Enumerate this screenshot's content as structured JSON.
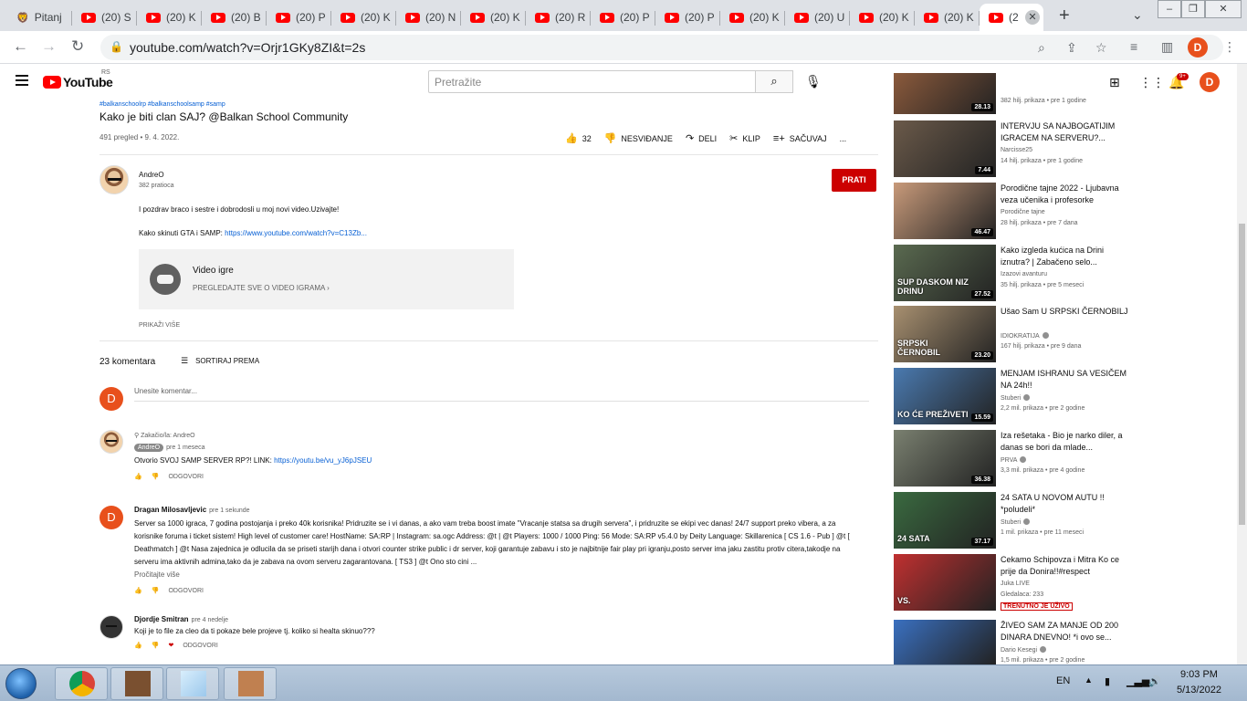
{
  "browser": {
    "tabs": [
      {
        "label": "Pitanj"
      },
      {
        "label": "(20) S"
      },
      {
        "label": "(20) K"
      },
      {
        "label": "(20) B"
      },
      {
        "label": "(20) P"
      },
      {
        "label": "(20) K"
      },
      {
        "label": "(20) N"
      },
      {
        "label": "(20) K"
      },
      {
        "label": "(20) R"
      },
      {
        "label": "(20) P"
      },
      {
        "label": "(20) P"
      },
      {
        "label": "(20) K"
      },
      {
        "label": "(20) U"
      },
      {
        "label": "(20) K"
      },
      {
        "label": "(20) K"
      },
      {
        "label": "(2"
      }
    ],
    "url": "youtube.com/watch?v=Orjr1GKy8ZI&t=2s",
    "profile_initial": "D"
  },
  "youtube": {
    "logo_text": "YouTube",
    "region": "RS",
    "search_placeholder": "Pretražite",
    "notif_count": "9+",
    "avatar_initial": "D"
  },
  "video": {
    "hashtags": "#balkanschoolrp #balkanschoolsamp #samp",
    "title": "Kako je biti clan SAJ? @Balkan School Community",
    "meta": "491 pregled • 9. 4. 2022.",
    "likes": "32",
    "dislike_label": "NESVIĐANJE",
    "share_label": "DELI",
    "clip_label": "KLIP",
    "save_label": "SAČUVAJ",
    "more_label": "...",
    "channel_name": "AndreO",
    "subscribers": "382 pratioca",
    "subscribe_label": "PRATI",
    "desc_line1": "I pozdrav braco i sestre i dobrodosli u moj novi video.Uzivajte!",
    "desc_line2_prefix": "Kako skinuti GTA i SAMP: ",
    "desc_link": "https://www.youtube.com/watch?v=C13Zb...",
    "game_title": "Video igre",
    "game_sub": "PREGLEDAJTE SVE O VIDEO IGRAMA  ›",
    "show_more": "PRIKAŽI VIŠE"
  },
  "comments": {
    "count": "23 komentara",
    "sort_label": "SORTIRAJ PREMA",
    "add_placeholder": "Unesite komentar...",
    "user_initial": "D",
    "reply_label": "ODGOVORI",
    "items": [
      {
        "pinned": "Zakačio/la: AndreO",
        "author": "AndreO",
        "time": "pre 1 meseca",
        "text_prefix": "Otvorio SVOJ SAMP SERVER RP?! LINK: ",
        "link": "https://youtu.be/vu_yJ6pJSEU"
      },
      {
        "author": "Dragan Milosavljevic",
        "time": "pre 1 sekunde",
        "text": "Server sa 1000 igraca, 7 godina postojanja i preko 40k korisnika! Pridruzite se i vi danas, a ako vam treba boost imate \"Vracanje statsa sa drugih servera\", i pridruzite se ekipi vec danas! 24/7 support preko vibera, a za korisnike foruma i ticket sistem! High level of customer care! HostName: SA:RP | Instagram: sa.ogc Address: @t | @t Players: 1000 / 1000 Ping: 56 Mode: SA:RP v5.4.0 by Deity Language: Skillarenica [ CS 1.6 - Pub ] @t [ Deathmatch ] @t Nasa zajednica je odlucila da se priseti starijh dana i otvori counter strike public i dr server, koji garantuje zabavu i sto je najbitnije fair play pri igranju,posto server ima jaku zastitu protiv citera,takodje na serveru ima aktivnih admina,tako da je zabava na ovom serveru zagarantovana. [ TS3 ] @t Ono sto cini ...",
        "read_more": "Pročitajte više"
      },
      {
        "author": "Djordje Smitran",
        "time": "pre 4 nedelje",
        "text": "Koji je to file za cleo da ti pokaze bele projeve tj. koliko si healta skinuo???"
      }
    ]
  },
  "sidebar": {
    "items": [
      {
        "title": "",
        "channel": "",
        "meta": "382 hilj. prikaza • pre 1 godine",
        "duration": "28.13",
        "color": "#8b5a3c"
      },
      {
        "title": "INTERVJU SA NAJBOGATIJIM IGRACEM NA SERVERU?...",
        "channel": "Narcisse25",
        "meta": "14 hilj. prikaza • pre 1 godine",
        "duration": "7.44",
        "color": "#6b5a4a"
      },
      {
        "title": "Porodične tajne 2022 - Ljubavna veza učenika i profesorke",
        "channel": "Porodične tajne",
        "meta": "28 hilj. prikaza • pre 7 dana",
        "duration": "46.47",
        "color": "#c89a7a"
      },
      {
        "title": "Kako izgleda kućica na Drini iznutra? | Zabačeno selo...",
        "channel": "Izazovi avanturu",
        "meta": "35 hilj. prikaza • pre 5 meseci",
        "duration": "27.52",
        "color": "#5a6a50",
        "label": "SUP DASKOM NIZ DRINU"
      },
      {
        "title": "Ušao Sam U SRPSKI ČERNOBILJ",
        "channel": "IDIOKRATIJA",
        "meta": "167 hilj. prikaza • pre 9 dana",
        "duration": "23.20",
        "color": "#a89070",
        "verified": true,
        "label": "SRPSKI ČERNOBIL"
      },
      {
        "title": "MENJAM ISHRANU SA VESIČEM NA 24h!!",
        "channel": "Stuberi",
        "meta": "2,2 mil. prikaza • pre 2 godine",
        "duration": "15.59",
        "color": "#4a7ab0",
        "verified": true,
        "label": "KO ĆE PREŽIVETI"
      },
      {
        "title": "Iza rešetaka - Bio je narko diler, a danas se bori da mlade...",
        "channel": "PRVA",
        "meta": "3,3 mil. prikaza • pre 4 godine",
        "duration": "36.38",
        "color": "#7a8070",
        "verified": true
      },
      {
        "title": "24 SATA U NOVOM AUTU !! *poludeli*",
        "channel": "Stuberi",
        "meta": "1 mil. prikaza • pre 11 meseci",
        "duration": "37.17",
        "color": "#3a6a40",
        "verified": true,
        "label": "24 SATA"
      },
      {
        "title": "Cekamo Schipovza i Mitra Ko ce prije da Donira!!#respect",
        "channel": "Juka LIVE",
        "meta": "Gledalaca: 233",
        "duration": "",
        "color": "#c03030",
        "live": "TRENUTNO JE UŽIVO",
        "label": "VS."
      },
      {
        "title": "ŽIVEO SAM ZA MANJE OD 200 DINARA DNEVNO! *i ovo se...",
        "channel": "Dario Kesegi",
        "meta": "1,5 mil. prikaza • pre 2 godine",
        "duration": "",
        "color": "#3a70c0",
        "verified": true
      }
    ]
  },
  "taskbar": {
    "lang": "EN",
    "time": "9:03 PM",
    "date": "5/13/2022"
  }
}
